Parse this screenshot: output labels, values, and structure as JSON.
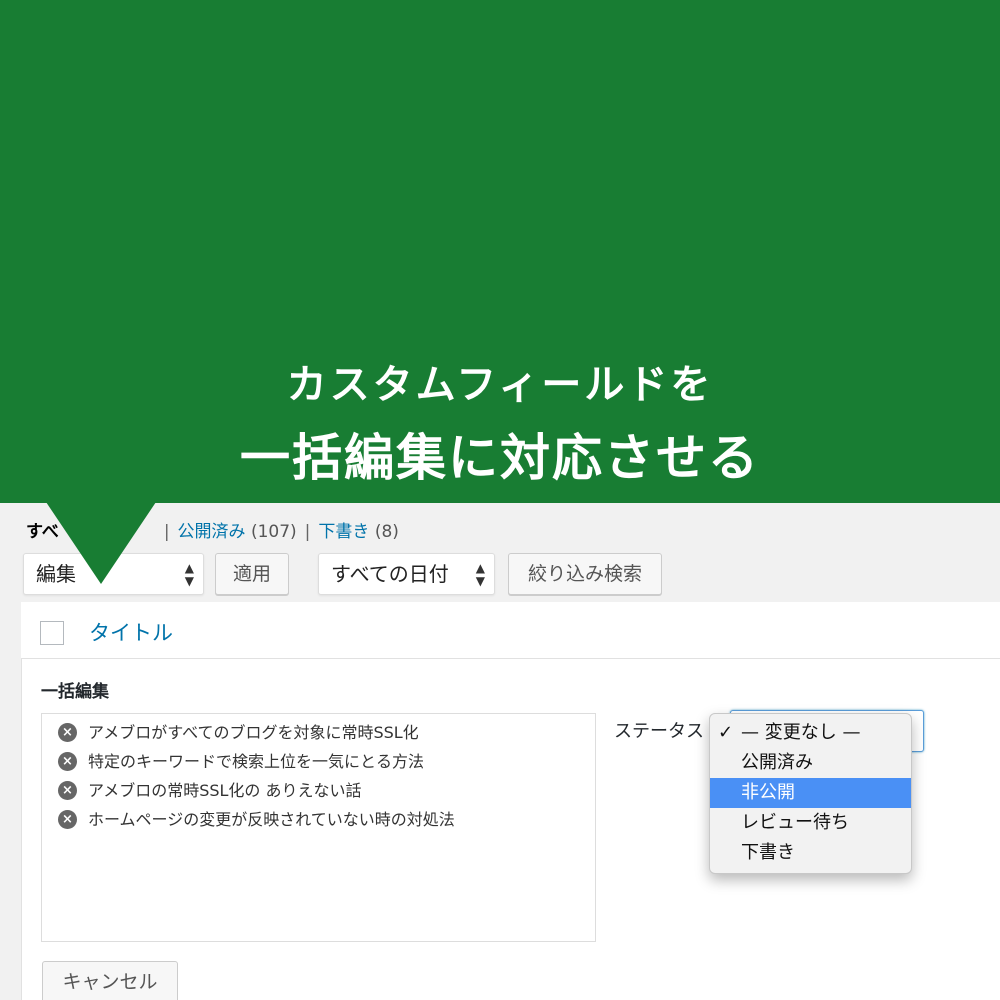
{
  "banner": {
    "line1": "カスタムフィールドを",
    "line2": "一括編集に対応させる",
    "color": "#187d33"
  },
  "subsubsub": {
    "all_label": "すべ",
    "published_label": "公開済み",
    "published_count": "(107)",
    "draft_label": "下書き",
    "draft_count": "(8)",
    "separator": "|"
  },
  "toolbar": {
    "bulk_action_value": "編集",
    "apply_label": "適用",
    "date_filter_value": "すべての日付",
    "filter_label": "絞り込み検索"
  },
  "table": {
    "title_column": "タイトル"
  },
  "bulk_edit": {
    "heading": "一括編集",
    "posts": [
      "アメブロがすべてのブログを対象に常時SSL化",
      "特定のキーワードで検索上位を一気にとる方法",
      "アメブロの常時SSL化の ありえない話",
      "ホームページの変更が反映されていない時の対処法"
    ],
    "remove_icon": "x-circle-icon",
    "status_label": "ステータス",
    "status_options": [
      "— 変更なし —",
      "公開済み",
      "非公開",
      "レビュー待ち",
      "下書き"
    ],
    "checked_option": "— 変更なし —",
    "highlighted_option": "非公開",
    "cancel_label": "キャンセル"
  },
  "colors": {
    "link": "#0073aa",
    "highlight": "#4a90f5"
  }
}
